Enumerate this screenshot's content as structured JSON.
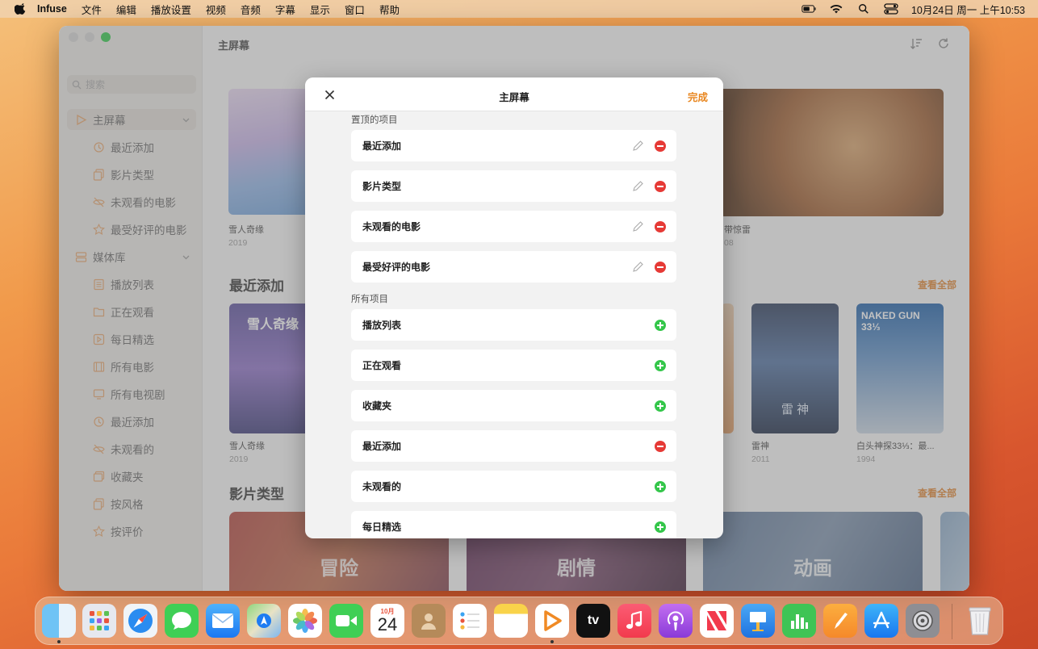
{
  "menubar": {
    "app_name": "Infuse",
    "menus": [
      "文件",
      "编辑",
      "播放设置",
      "视频",
      "音频",
      "字幕",
      "显示",
      "窗口",
      "帮助"
    ],
    "datetime": "10月24日 周一  上午10:53"
  },
  "sidebar": {
    "search_placeholder": "搜索",
    "sections": [
      {
        "label": "主屏幕",
        "items": [
          "最近添加",
          "影片类型",
          "未观看的电影",
          "最受好评的电影"
        ]
      },
      {
        "label": "媒体库",
        "items": [
          "播放列表",
          "正在观看",
          "每日精选",
          "所有电影",
          "所有电视剧",
          "最近添加",
          "未观看的",
          "收藏夹",
          "按风格",
          "按评价"
        ]
      }
    ]
  },
  "main": {
    "title": "主屏幕",
    "hero": [
      {
        "title": "雪人奇缘",
        "year": "2019"
      },
      {
        "title": "带惊雷",
        "year": "08"
      }
    ],
    "recent_title": "最近添加",
    "see_all": "查看全部",
    "recent": [
      {
        "title": "雪人奇缘",
        "year": "2019",
        "poster_text": "雪人奇缘"
      },
      {
        "title": "雷神",
        "year": "2011",
        "poster_text": "雷 神"
      },
      {
        "title": "白头神探33⅓：最...",
        "year": "1994",
        "poster_text": "NAKED GUN 33⅓"
      }
    ],
    "genres_title": "影片类型",
    "genres": [
      "冒险",
      "剧情",
      "动画"
    ]
  },
  "modal": {
    "title": "主屏幕",
    "done": "完成",
    "pinned_header": "置顶的项目",
    "pinned": [
      "最近添加",
      "影片类型",
      "未观看的电影",
      "最受好评的电影"
    ],
    "all_header": "所有项目",
    "all": [
      {
        "label": "播放列表",
        "state": "add"
      },
      {
        "label": "正在观看",
        "state": "add"
      },
      {
        "label": "收藏夹",
        "state": "add"
      },
      {
        "label": "最近添加",
        "state": "remove"
      },
      {
        "label": "未观看的",
        "state": "add"
      },
      {
        "label": "每日精选",
        "state": "add"
      }
    ]
  },
  "dock": {
    "apps": [
      "Finder",
      "Launchpad",
      "Safari",
      "Messages",
      "Mail",
      "Maps",
      "Photos",
      "FaceTime",
      "Calendar",
      "Contacts",
      "Reminders",
      "Notes",
      "Infuse",
      "TV",
      "Music",
      "Podcasts",
      "News",
      "Keynote",
      "Numbers",
      "Pages",
      "App Store",
      "System Settings"
    ],
    "calendar_month": "10月",
    "calendar_day": "24",
    "tv_label": "tv"
  },
  "colors": {
    "accent": "#e8861f",
    "remove": "#e63a36",
    "add": "#34c64a"
  }
}
